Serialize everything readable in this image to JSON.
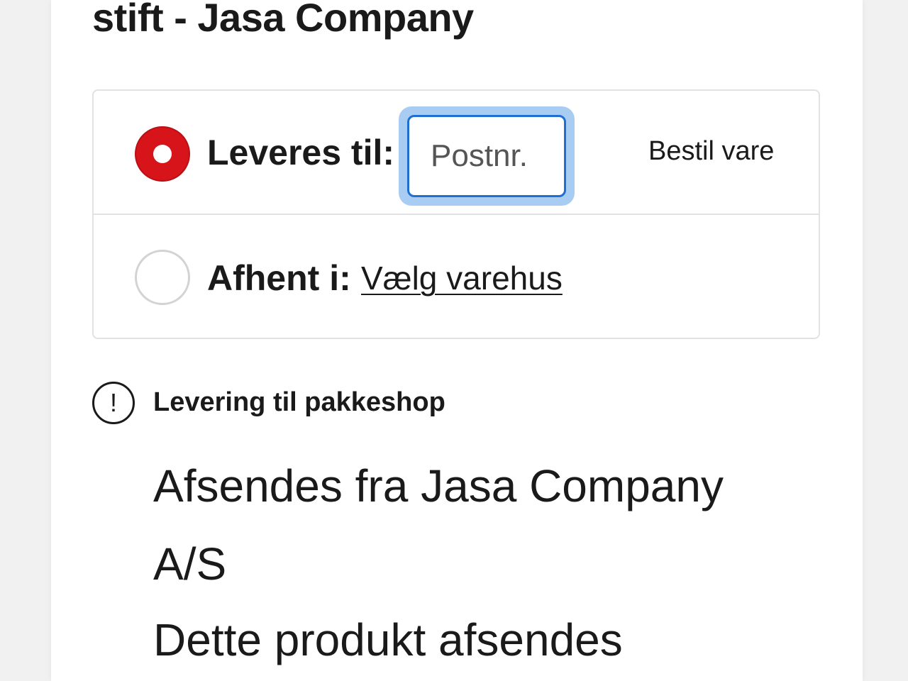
{
  "product": {
    "title": "stift - Jasa Company"
  },
  "delivery_options": {
    "deliver": {
      "label": "Leveres til:",
      "postcode_placeholder": "Postnr.",
      "postcode_value": "",
      "order_button": "Bestil vare",
      "selected": true
    },
    "pickup": {
      "label": "Afhent i:",
      "store_link": "Vælg varehus",
      "selected": false
    }
  },
  "notice": {
    "icon": "exclamation-circle-icon",
    "text": "Levering til pakkeshop"
  },
  "shipping": {
    "heading": "Afsendes fra Jasa Company A/S",
    "body": "Dette produkt afsendes"
  },
  "colors": {
    "accent_red": "#d7141a",
    "focus_blue": "#1f6fd1",
    "focus_ring": "#a9cdf2"
  }
}
